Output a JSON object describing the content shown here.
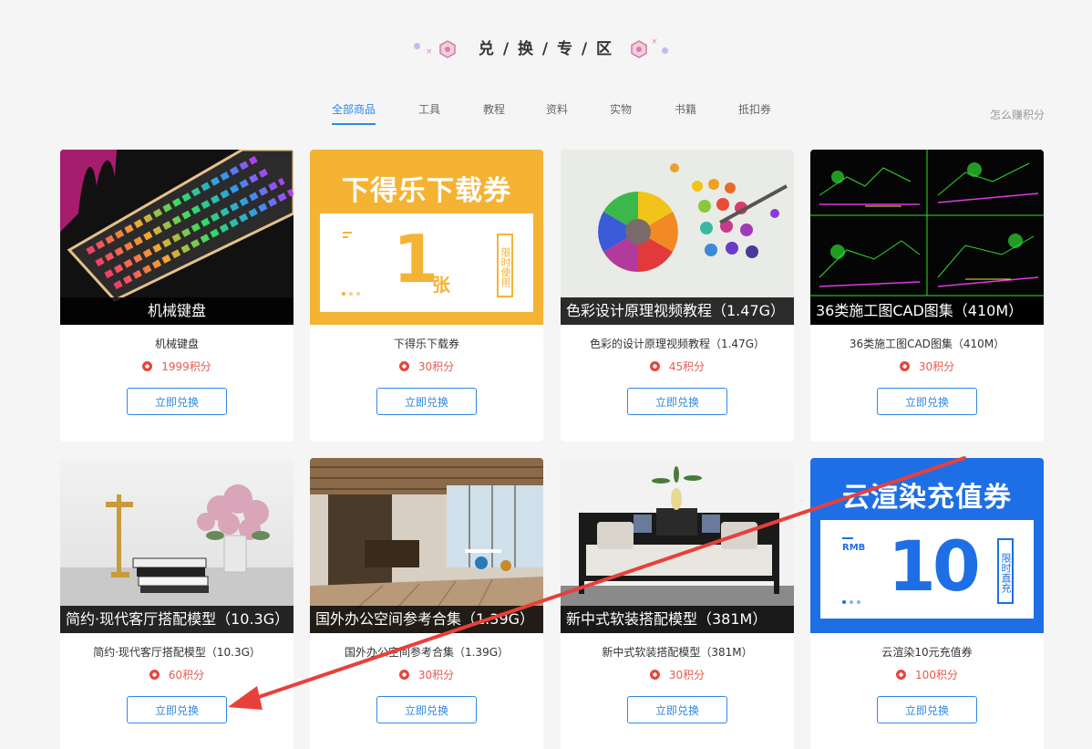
{
  "page": {
    "title": "兑 / 换 / 专 / 区",
    "earn_link": "怎么赚积分"
  },
  "tabs": [
    "全部商品",
    "工具",
    "教程",
    "资料",
    "实物",
    "书籍",
    "抵扣券"
  ],
  "active_tab": 0,
  "colors": {
    "accent": "#2f88e6",
    "points": "#e85a4f",
    "arrow": "#e8403a",
    "voucher_orange": "#f5b333",
    "voucher_blue": "#1e6fe6"
  },
  "products": [
    {
      "caption": "机械键盘",
      "name": "机械键盘",
      "points": "1999积分",
      "button": "立即兑换",
      "icon": "keyboard-image"
    },
    {
      "caption": "",
      "name": "下得乐下载券",
      "points": "30积分",
      "button": "立即兑换",
      "icon": "download-voucher-image",
      "voucher": {
        "title": "下得乐下载券",
        "amount": "1",
        "unit": "张",
        "tag": "限时使用"
      }
    },
    {
      "caption": "色彩设计原理视频教程（1.47G）",
      "name": "色彩的设计原理视频教程（1.47G）",
      "points": "45积分",
      "button": "立即兑换",
      "icon": "color-wheel-image"
    },
    {
      "caption": "36类施工图CAD图集（410M）",
      "name": "36类施工图CAD图集（410M）",
      "points": "30积分",
      "button": "立即兑换",
      "icon": "cad-drawing-image"
    },
    {
      "caption": "简约·现代客厅搭配模型（10.3G）",
      "name": "简约·现代客厅搭配模型（10.3G）",
      "points": "60积分",
      "button": "立即兑换",
      "icon": "living-room-image"
    },
    {
      "caption": "国外办公空间参考合集（1.39G）",
      "name": "国外办公空间参考合集（1.39G）",
      "points": "30积分",
      "button": "立即兑换",
      "icon": "office-space-image"
    },
    {
      "caption": "新中式软装搭配模型（381M）",
      "name": "新中式软装搭配模型（381M）",
      "points": "30积分",
      "button": "立即兑换",
      "icon": "chinese-sofa-image"
    },
    {
      "caption": "",
      "name": "云渲染10元充值券",
      "points": "100积分",
      "button": "立即兑换",
      "icon": "render-voucher-image",
      "voucher": {
        "title": "云渲染充值券",
        "currency": "RMB",
        "amount": "10",
        "tag": "限时直充"
      }
    }
  ]
}
